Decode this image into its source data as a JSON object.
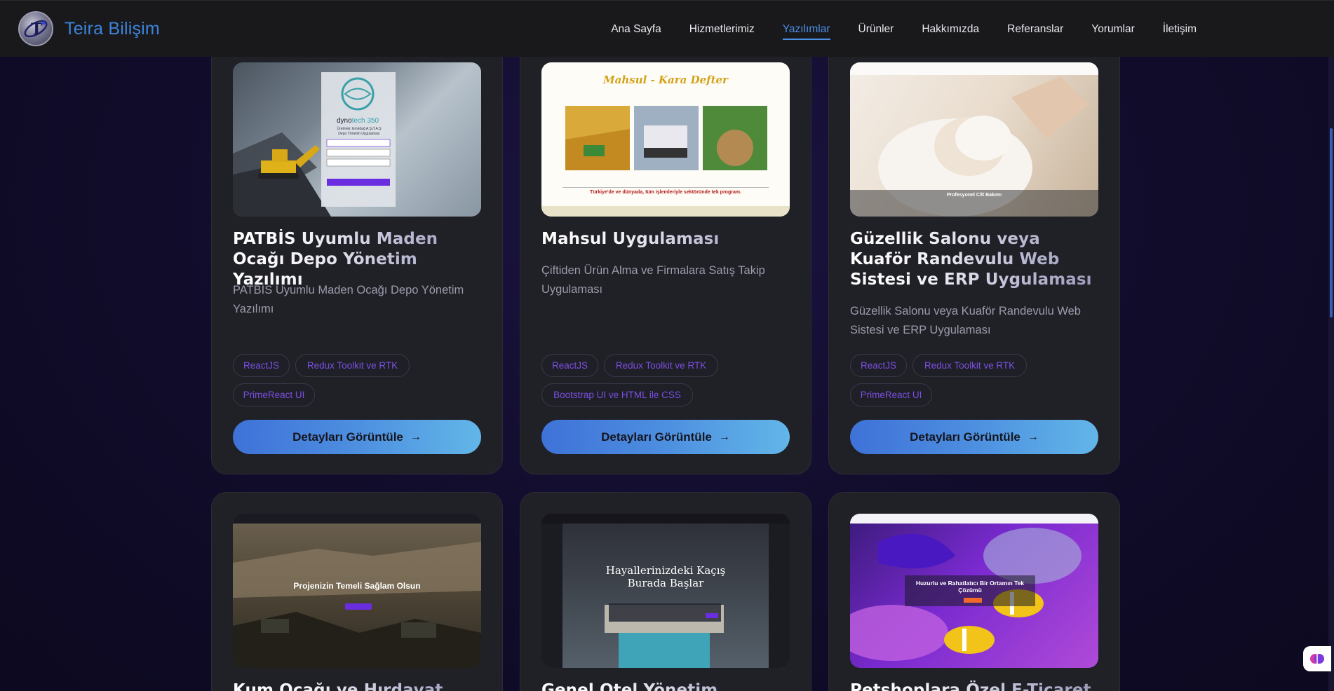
{
  "brand": {
    "name": "Teira Bilişim"
  },
  "nav": {
    "items": [
      {
        "label": "Ana Sayfa"
      },
      {
        "label": "Hizmetlerimiz"
      },
      {
        "label": "Yazılımlar"
      },
      {
        "label": "Ürünler"
      },
      {
        "label": "Hakkımızda"
      },
      {
        "label": "Referanslar"
      },
      {
        "label": "Yorumlar"
      },
      {
        "label": "İletişim"
      }
    ],
    "active": "Yazılımlar"
  },
  "cards": [
    {
      "title": "PATBİS Uyumlu Maden Ocağı Depo Yönetim Yazılımı",
      "description": "PATBİS Uyumlu Maden Ocağı Depo Yönetim Yazılımı",
      "tags": [
        "ReactJS",
        "Redux Toolkit ve RTK",
        "PrimeReact UI"
      ],
      "button": "Detayları Görüntüle",
      "shot": {
        "brand": "dyno",
        "brand_b": "tech",
        "brand_c": "350",
        "line1": "Üretmek: Emirdağ A.Ş./İ.A.Ş",
        "line2": "Depo Yönetim Uygulaması"
      }
    },
    {
      "title": "Mahsul Uygulaması",
      "description": "Çiftiden Ürün Alma ve Firmalara Satış Takip Uygulaması",
      "tags": [
        "ReactJS",
        "Redux Toolkit ve RTK",
        "Bootstrap UI ve HTML ile CSS"
      ],
      "button": "Detayları Görüntüle",
      "shot": {
        "heading": "Mahsul - Kara Defter",
        "footer": "Türkiye'de ve dünyada, tüm işlemleriyle sektöründe tek program."
      }
    },
    {
      "title": "Güzellik Salonu veya Kuaför Randevulu Web Sistesi ve ERP Uygulaması",
      "description": "Güzellik Salonu veya Kuaför Randevulu Web Sistesi ve ERP Uygulaması",
      "tags": [
        "ReactJS",
        "Redux Toolkit ve RTK",
        "PrimeReact UI"
      ],
      "button": "Detayları Görüntüle",
      "shot": {
        "caption": "Profesyonel Cilt Bakımı"
      }
    },
    {
      "title": "Kum Ocağı ve Hırdavat Satışı",
      "shot": {
        "heading": "Projenizin Temeli Sağlam Olsun"
      }
    },
    {
      "title": "Genel Otel Yönetim Sistemi ile",
      "shot": {
        "heading": "Hayallerinizdeki Kaçış Burada Başlar"
      }
    },
    {
      "title": "Petshoplara Özel E-Ticaret ve",
      "shot": {
        "heading": "Huzurlu ve Rahatlatıcı Bir Ortamın Tek Çözümü"
      }
    }
  ],
  "colors": {
    "accent": "#4c8fe6",
    "tag_text": "#7a4fe0",
    "button_start": "#3f72d8",
    "button_end": "#62b6e8",
    "card_bg": "#202027",
    "page_bg": "#110c2a"
  }
}
